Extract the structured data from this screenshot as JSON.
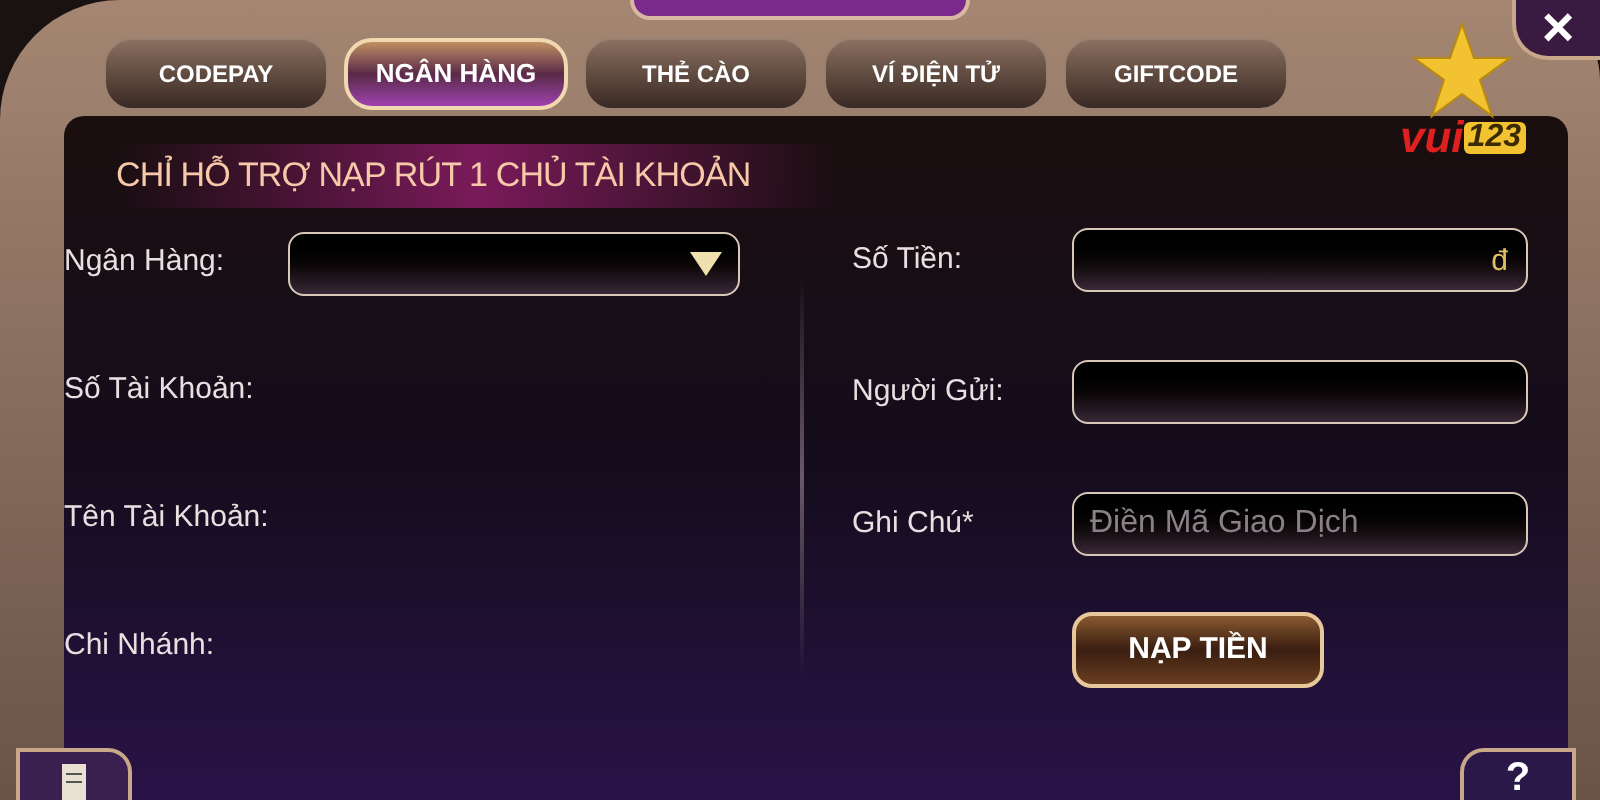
{
  "tabs": [
    {
      "label": "CODEPAY",
      "selected": false
    },
    {
      "label": "NGÂN HÀNG",
      "selected": true
    },
    {
      "label": "THẺ CÀO",
      "selected": false
    },
    {
      "label": "VÍ ĐIỆN TỬ",
      "selected": false
    },
    {
      "label": "GIFTCODE",
      "selected": false
    }
  ],
  "close_button": "×",
  "logo": {
    "word": "vui",
    "number": "123"
  },
  "notice": "CHỈ HỖ TRỢ NẠP RÚT 1 CHỦ TÀI KHOẢN",
  "left_fields": [
    {
      "label": "Ngân Hàng:",
      "kind": "dropdown"
    },
    {
      "label": "Số Tài Khoản:",
      "kind": "info"
    },
    {
      "label": "Tên Tài Khoản:",
      "kind": "info"
    },
    {
      "label": "Chi Nhánh:",
      "kind": "info"
    }
  ],
  "right_fields": [
    {
      "label": "Số Tiền:",
      "suffix": "đ"
    },
    {
      "label": "Người Gửi:"
    },
    {
      "label": "Ghi Chú*",
      "placeholder": "Điền Mã Giao Dịch"
    }
  ],
  "submit_button": "NẠP TIỀN",
  "help_button": "?"
}
